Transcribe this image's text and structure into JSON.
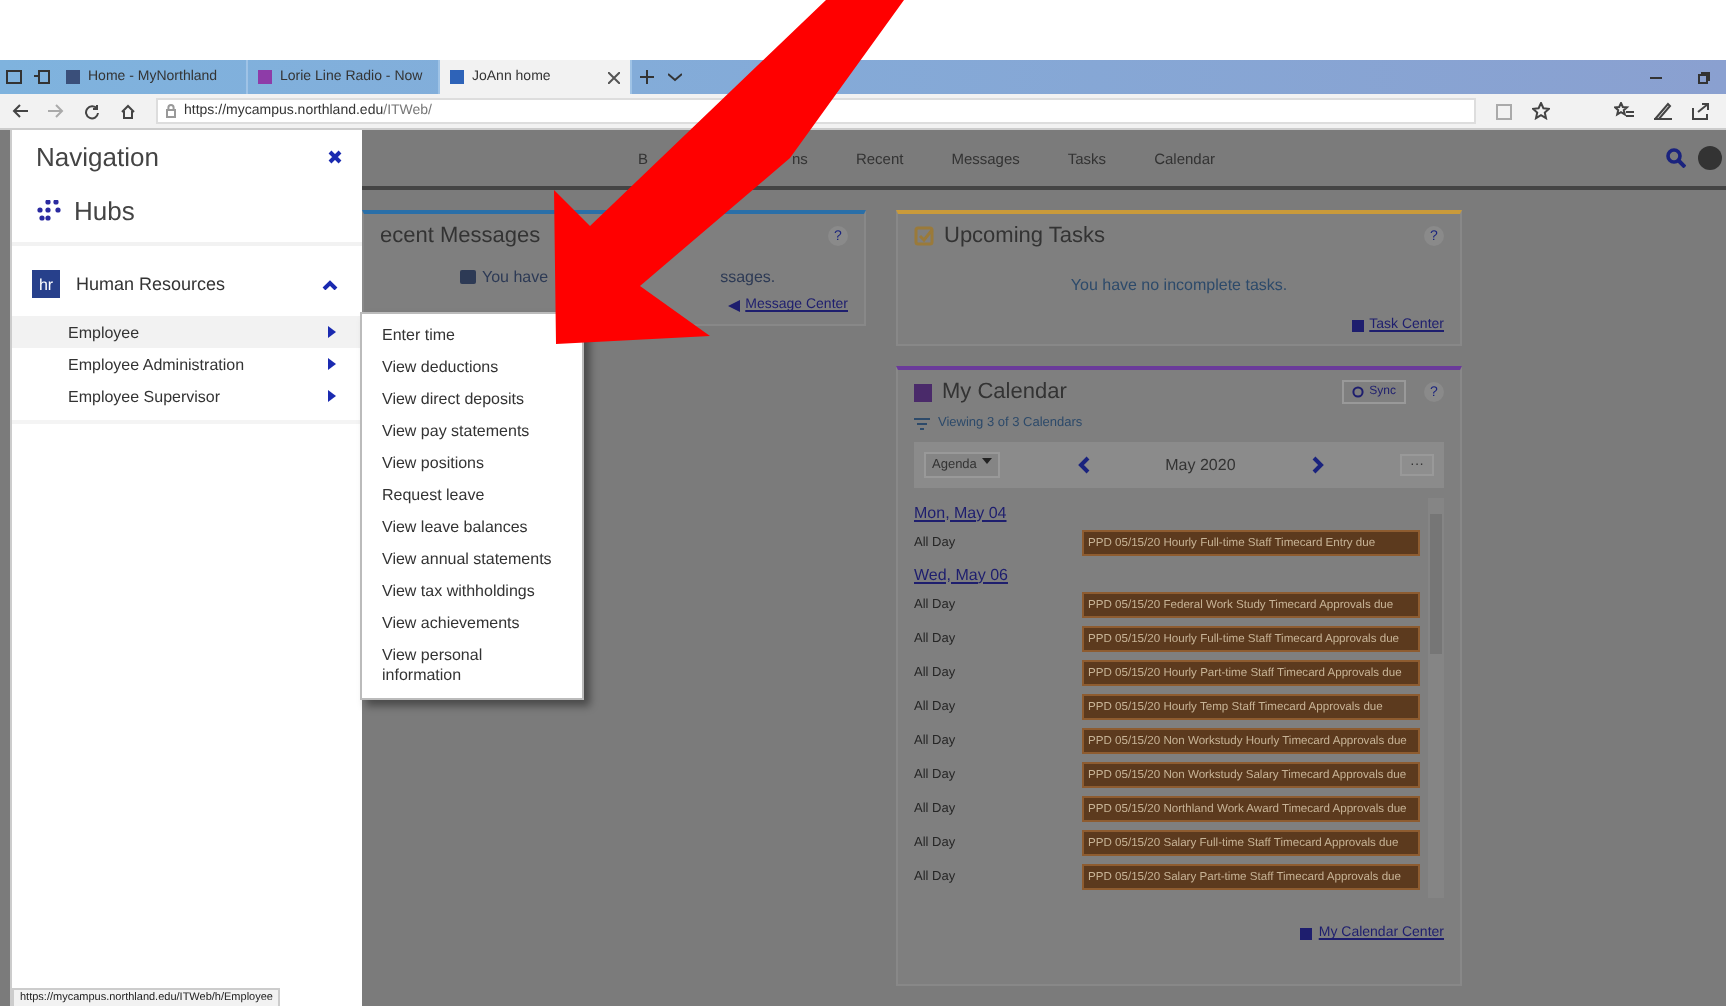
{
  "browser": {
    "tabs": [
      {
        "title": "Home - MyNorthland",
        "selected": false
      },
      {
        "title": "Lorie Line Radio - Now",
        "selected": false
      },
      {
        "title": "JoAnn home",
        "selected": true
      }
    ],
    "url_host": "https://mycampus.northland.edu",
    "url_path": "/ITWeb/"
  },
  "top_nav": [
    {
      "label": "B"
    },
    {
      "label": "ns"
    },
    {
      "label": "Recent"
    },
    {
      "label": "Messages"
    },
    {
      "label": "Tasks"
    },
    {
      "label": "Calendar"
    }
  ],
  "navigation": {
    "title": "Navigation",
    "hubs": "Hubs",
    "section": {
      "label": "Human Resources",
      "badge": "hr",
      "expanded": true,
      "items": [
        {
          "label": "Employee",
          "selected": true
        },
        {
          "label": "Employee Administration",
          "selected": false
        },
        {
          "label": "Employee Supervisor",
          "selected": false
        }
      ]
    }
  },
  "submenu": [
    "Enter time",
    "View deductions",
    "View direct deposits",
    "View pay statements",
    "View positions",
    "Request leave",
    "View leave balances",
    "View annual statements",
    "View tax withholdings",
    "View achievements",
    "View personal information"
  ],
  "recent_messages": {
    "title": "ecent Messages",
    "help": "?",
    "message_start": "You have",
    "message_end": "ssages.",
    "link": "Message Center"
  },
  "upcoming_tasks": {
    "title": "Upcoming Tasks",
    "help": "?",
    "message": "You have no incomplete tasks.",
    "link": "Task Center"
  },
  "calendar": {
    "title": "My Calendar",
    "sync": "Sync",
    "help": "?",
    "filter": "Viewing 3 of 3 Calendars",
    "view": "Agenda",
    "month": "May 2020",
    "more": "···",
    "link": "My Calendar Center",
    "days": [
      {
        "date": "Mon, May 04",
        "events": [
          {
            "time": "All Day",
            "title": "PPD 05/15/20 Hourly Full-time Staff Timecard Entry due"
          }
        ]
      },
      {
        "date": "Wed, May 06",
        "events": [
          {
            "time": "All Day",
            "title": "PPD 05/15/20 Federal Work Study Timecard Approvals due"
          },
          {
            "time": "All Day",
            "title": "PPD 05/15/20 Hourly Full-time Staff Timecard Approvals due"
          },
          {
            "time": "All Day",
            "title": "PPD 05/15/20 Hourly Part-time Staff Timecard Approvals due"
          },
          {
            "time": "All Day",
            "title": "PPD 05/15/20 Hourly Temp Staff Timecard Approvals due"
          },
          {
            "time": "All Day",
            "title": "PPD 05/15/20 Non Workstudy Hourly Timecard Approvals due"
          },
          {
            "time": "All Day",
            "title": "PPD 05/15/20 Non Workstudy Salary Timecard Approvals due"
          },
          {
            "time": "All Day",
            "title": "PPD 05/15/20 Northland Work Award Timecard Approvals due"
          },
          {
            "time": "All Day",
            "title": "PPD 05/15/20 Salary Full-time Staff Timecard Approvals due"
          },
          {
            "time": "All Day",
            "title": "PPD 05/15/20 Salary Part-time Staff Timecard Approvals due"
          }
        ]
      }
    ]
  },
  "status_url": "https://mycampus.northland.edu/ITWeb/h/Employee"
}
